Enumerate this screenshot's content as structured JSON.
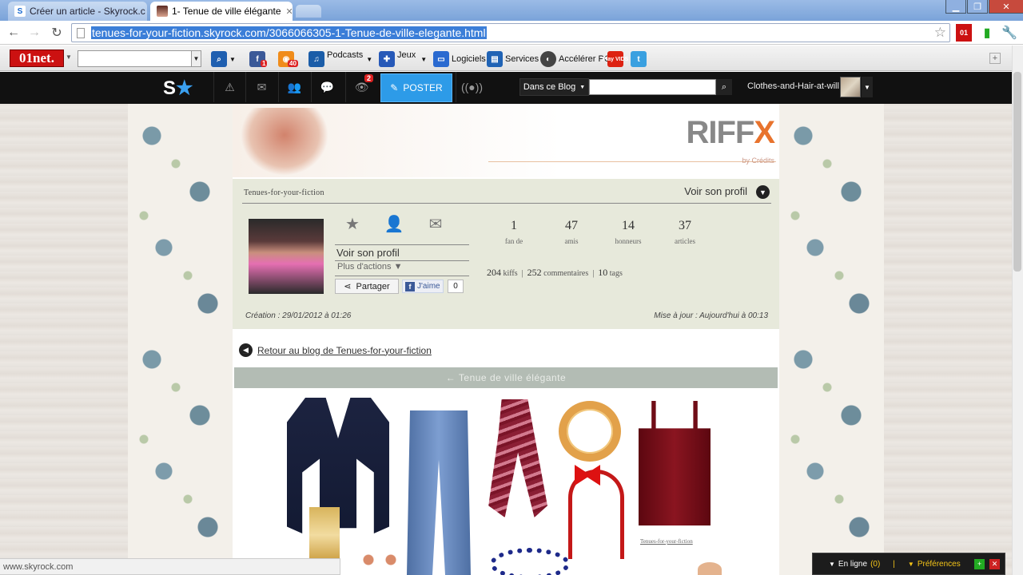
{
  "browser": {
    "tabs": [
      {
        "label": "Créer un article - Skyrock.c",
        "favicon": "skyrock-favicon"
      },
      {
        "label": "1- Tenue de ville élégante",
        "favicon": "photo-favicon"
      }
    ],
    "url_highlight": "tenues-for-your-fiction.skyrock.com/3066066305-1-Tenue-de-ville-elegante.html",
    "status_url": "www.skyrock.com"
  },
  "toolbar01": {
    "logo": "01net.",
    "items": {
      "podcasts": "Podcasts",
      "jeux": "Jeux",
      "logiciels": "Logiciels",
      "services": "Services",
      "accelerer": "Accélérer PC",
      "play": "Play VIDS"
    },
    "facebook_badge": "1",
    "rss_badge": "40"
  },
  "skybar": {
    "notif_badge": "2",
    "poster_label": "POSTER",
    "blog_select": "Dans ce Blog",
    "username": "Clothes-and-Hair-at-will"
  },
  "banner": {
    "brand_main": "RIFF",
    "brand_x": "X",
    "by_line": "by Crédits"
  },
  "profile": {
    "name": "Tenues-for-your-fiction",
    "voir_top": "Voir son profil",
    "voir_profil": "Voir son profil",
    "plus_actions": "Plus d'actions ▼",
    "share": "Partager",
    "like": "J'aime",
    "like_count": "0",
    "stats": [
      {
        "n": "1",
        "l": "fan de"
      },
      {
        "n": "47",
        "l": "amis"
      },
      {
        "n": "14",
        "l": "honneurs"
      },
      {
        "n": "37",
        "l": "articles"
      }
    ],
    "kiffs_n": "204",
    "kiffs_l": "kiffs",
    "comments_n": "252",
    "comments_l": "commentaires",
    "tags_n": "10",
    "tags_l": "tags",
    "creation": "Création : 29/01/2012 à 01:26",
    "maj": "Mise à jour : Aujourd'hui à 00:13"
  },
  "article": {
    "back": "Retour au blog de Tenues-for-your-fiction",
    "title": "← Tenue de ville élégante",
    "caption": "Tenues-for-your-fiction"
  },
  "chat": {
    "online_label": "En ligne",
    "online_count": "(0)",
    "prefs": "Préférences"
  }
}
